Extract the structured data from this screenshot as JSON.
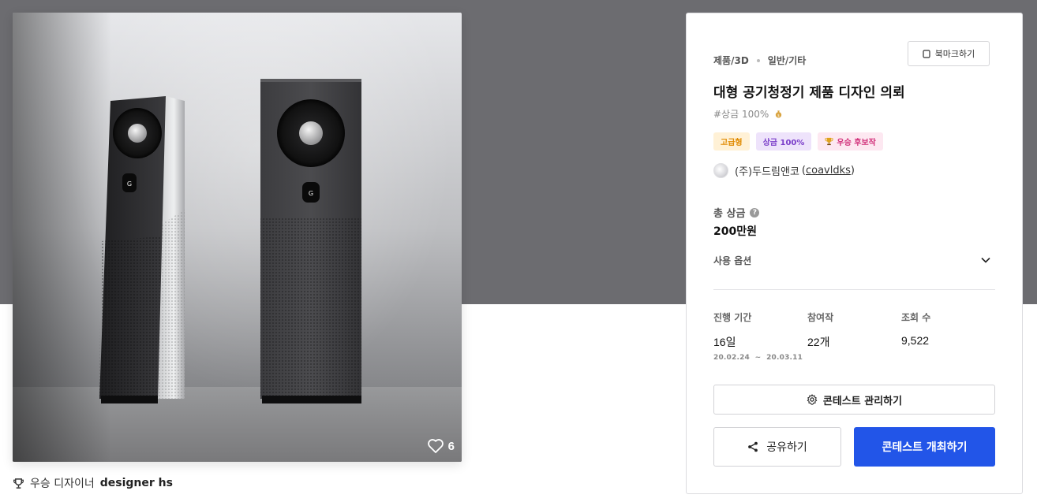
{
  "gallery": {
    "like_count": "6",
    "winner_prefix": "우승 디자이너",
    "winner_name": "designer hs"
  },
  "contest": {
    "category": "제품/3D",
    "subcategory": "일반/기타",
    "bookmark_label": "북마크하기",
    "title": "대형 공기청정기 제품 디자인 의뢰",
    "hashtag": "#상금 100%",
    "tags": [
      "고급형",
      "상금 100%",
      "우승 후보작"
    ],
    "host_name": "(주)두드림앤코",
    "host_id": "coavldks"
  },
  "prize": {
    "label": "총 상금",
    "help": "?",
    "value": "200만원",
    "usage_label": "사용 옵션"
  },
  "stats": {
    "period_label": "진행 기간",
    "period_value": "16일",
    "period_range": "20.02.24  ~  20.03.11",
    "entries_label": "참여작",
    "entries_value": "22개",
    "views_label": "조회 수",
    "views_value": "9,522"
  },
  "actions": {
    "manage_label": "콘테스트 관리하기",
    "share_label": "공유하기",
    "host_label": "콘테스트 개최하기"
  },
  "colors": {
    "hero_bg": "#6c6c70",
    "primary": "#2255e8",
    "tag_premium": "#e08a00",
    "tag_prize": "#7a3dc9",
    "tag_candidate": "#d1307a"
  }
}
